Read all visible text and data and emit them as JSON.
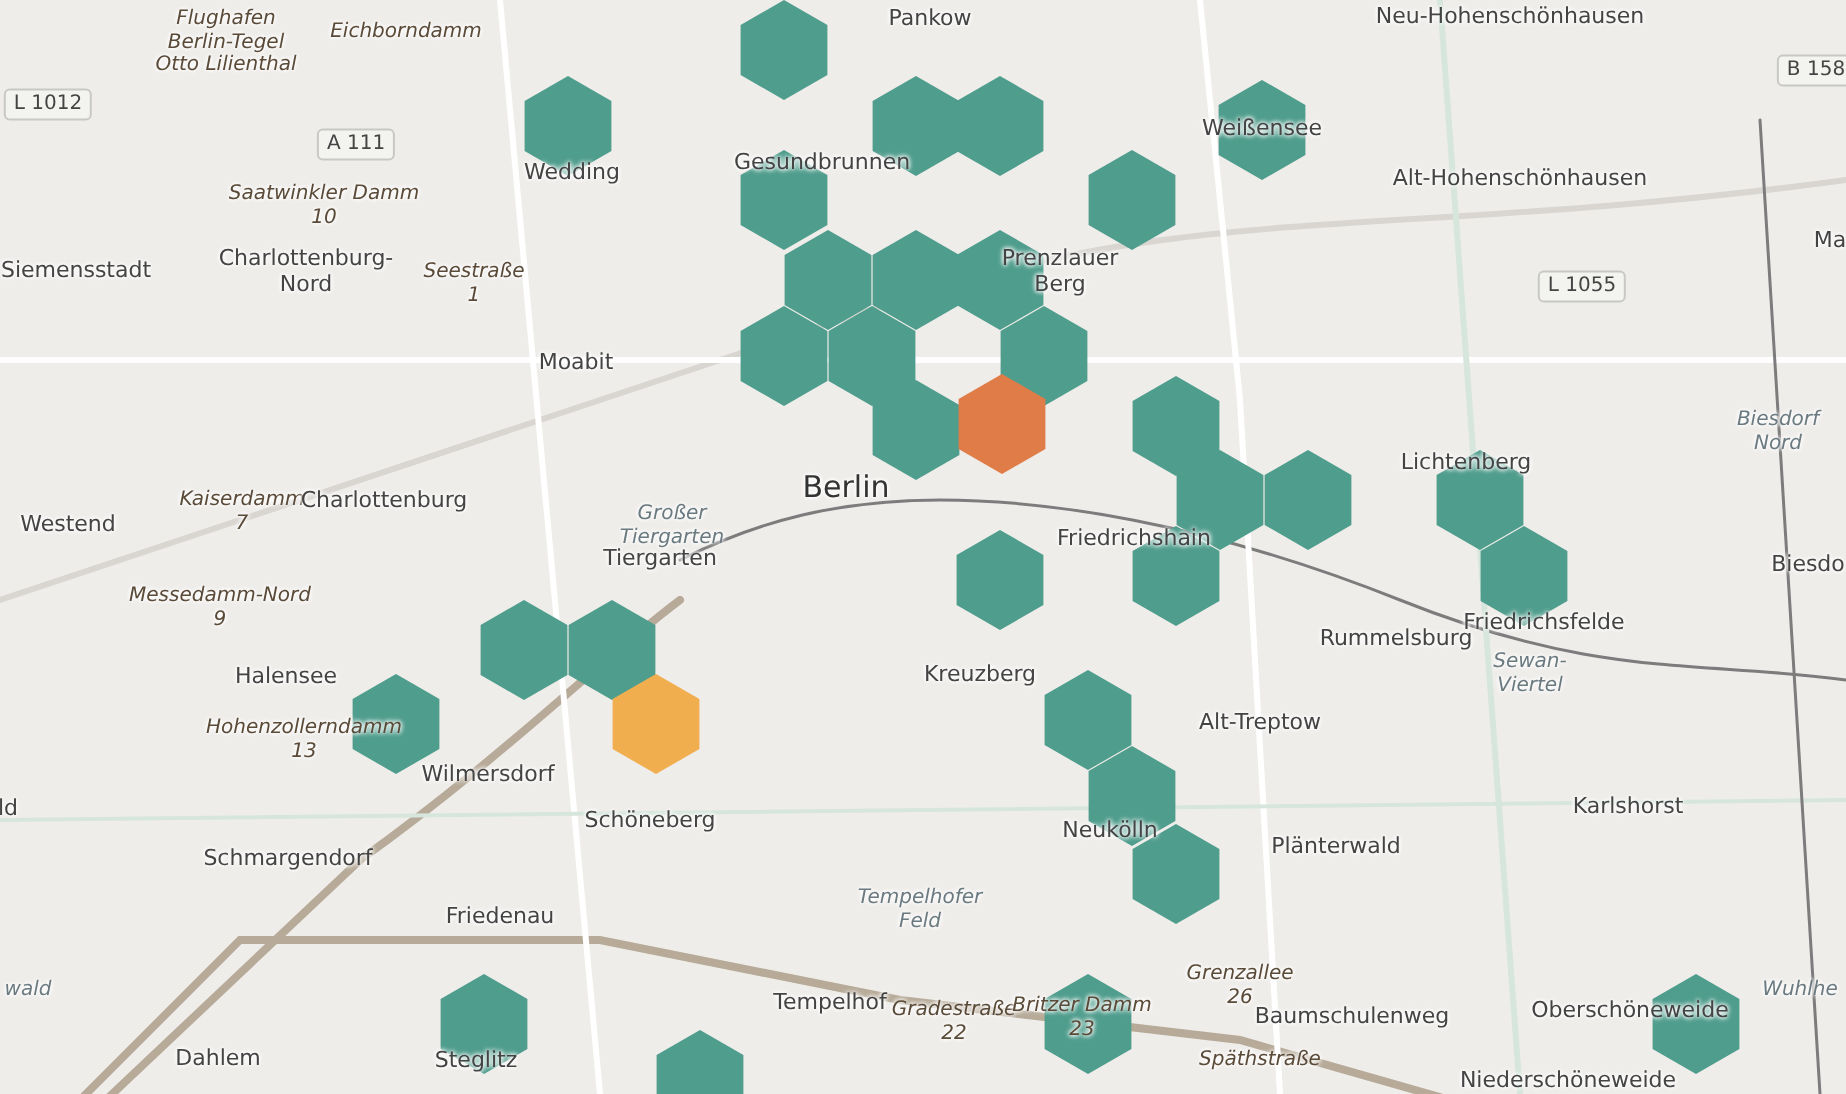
{
  "map": {
    "labels": [
      {
        "kind": "street",
        "text": "Flughafen\nBerlin-Tegel\nOtto Lilienthal"
      },
      {
        "kind": "street",
        "text": "Eichborndamm"
      },
      {
        "kind": "district",
        "text": "Pankow"
      },
      {
        "kind": "district",
        "text": "Neu-Hohenschönhausen"
      },
      {
        "kind": "shield",
        "text": "B 158"
      },
      {
        "kind": "shield",
        "text": "L 1012"
      },
      {
        "kind": "shield",
        "text": "A 111"
      },
      {
        "kind": "district",
        "text": "Weißensee"
      },
      {
        "kind": "district",
        "text": "Gesundbrunnen"
      },
      {
        "kind": "district",
        "text": "Wedding"
      },
      {
        "kind": "district",
        "text": "Alt-Hohenschönhausen"
      },
      {
        "kind": "street",
        "text": "Saatwinkler Damm\n10"
      },
      {
        "kind": "district",
        "text": "Ma"
      },
      {
        "kind": "district",
        "text": "Siemensstadt"
      },
      {
        "kind": "district",
        "text": "Charlottenburg-\nNord"
      },
      {
        "kind": "street",
        "text": "Seestraße\n1"
      },
      {
        "kind": "district",
        "text": "Prenzlauer\nBerg"
      },
      {
        "kind": "shield",
        "text": "L 1055"
      },
      {
        "kind": "district",
        "text": "Moabit"
      },
      {
        "kind": "park",
        "text": "Biesdorf\nNord"
      },
      {
        "kind": "district",
        "text": "Lichtenberg"
      },
      {
        "kind": "city",
        "text": "Berlin"
      },
      {
        "kind": "district",
        "text": "Westend"
      },
      {
        "kind": "street",
        "text": "Kaiserdamm\n7"
      },
      {
        "kind": "district",
        "text": "Charlottenburg"
      },
      {
        "kind": "park",
        "text": "Großer\nTiergarten"
      },
      {
        "kind": "district",
        "text": "Tiergarten"
      },
      {
        "kind": "district",
        "text": "Friedrichshain"
      },
      {
        "kind": "district",
        "text": "Biesdo"
      },
      {
        "kind": "street",
        "text": "Messedamm-Nord\n9"
      },
      {
        "kind": "district",
        "text": "Rummelsburg"
      },
      {
        "kind": "district",
        "text": "Friedrichsfelde"
      },
      {
        "kind": "district",
        "text": "Halensee"
      },
      {
        "kind": "district",
        "text": "Kreuzberg"
      },
      {
        "kind": "park",
        "text": "Sewan-\nViertel"
      },
      {
        "kind": "street",
        "text": "Hohenzollerndamm\n13"
      },
      {
        "kind": "district",
        "text": "Alt-Treptow"
      },
      {
        "kind": "district",
        "text": "Wilmersdorf"
      },
      {
        "kind": "district",
        "text": "ld"
      },
      {
        "kind": "district",
        "text": "Schöneberg"
      },
      {
        "kind": "district",
        "text": "Neukölln"
      },
      {
        "kind": "district",
        "text": "Karlshorst"
      },
      {
        "kind": "district",
        "text": "Schmargendorf"
      },
      {
        "kind": "district",
        "text": "Plänterwald"
      },
      {
        "kind": "district",
        "text": "Friedenau"
      },
      {
        "kind": "park",
        "text": "Tempelhofer\nFeld"
      },
      {
        "kind": "park",
        "text": "wald"
      },
      {
        "kind": "district",
        "text": "Tempelhof"
      },
      {
        "kind": "street",
        "text": "Gradestraße\n22"
      },
      {
        "kind": "street",
        "text": "Britzer Damm\n23"
      },
      {
        "kind": "street",
        "text": "Grenzallee\n26"
      },
      {
        "kind": "district",
        "text": "Baumschulenweg"
      },
      {
        "kind": "district",
        "text": "Oberschöneweide"
      },
      {
        "kind": "park",
        "text": "Wuhlhe"
      },
      {
        "kind": "district",
        "text": "Dahlem"
      },
      {
        "kind": "district",
        "text": "Steglitz"
      },
      {
        "kind": "street",
        "text": "Späthstraße"
      },
      {
        "kind": "district",
        "text": "Niederschöneweide"
      }
    ],
    "hexbins": [
      {
        "color": "#4f9d8d"
      },
      {
        "color": "#4f9d8d"
      },
      {
        "color": "#4f9d8d"
      },
      {
        "color": "#4f9d8d"
      },
      {
        "color": "#4f9d8d"
      },
      {
        "color": "#4f9d8d"
      },
      {
        "color": "#4f9d8d"
      },
      {
        "color": "#4f9d8d"
      },
      {
        "color": "#4f9d8d"
      },
      {
        "color": "#4f9d8d"
      },
      {
        "color": "#4f9d8d"
      },
      {
        "color": "#4f9d8d"
      },
      {
        "color": "#4f9d8d"
      },
      {
        "color": "#4f9d8d"
      },
      {
        "color": "#e07c48"
      },
      {
        "color": "#4f9d8d"
      },
      {
        "color": "#4f9d8d"
      },
      {
        "color": "#4f9d8d"
      },
      {
        "color": "#4f9d8d"
      },
      {
        "color": "#4f9d8d"
      },
      {
        "color": "#4f9d8d"
      },
      {
        "color": "#4f9d8d"
      },
      {
        "color": "#4f9d8d"
      },
      {
        "color": "#4f9d8d"
      },
      {
        "color": "#4f9d8d"
      },
      {
        "color": "#f0ae4f"
      },
      {
        "color": "#4f9d8d"
      },
      {
        "color": "#4f9d8d"
      },
      {
        "color": "#4f9d8d"
      },
      {
        "color": "#4f9d8d"
      },
      {
        "color": "#4f9d8d"
      },
      {
        "color": "#4f9d8d"
      },
      {
        "color": "#4f9d8d"
      }
    ]
  }
}
